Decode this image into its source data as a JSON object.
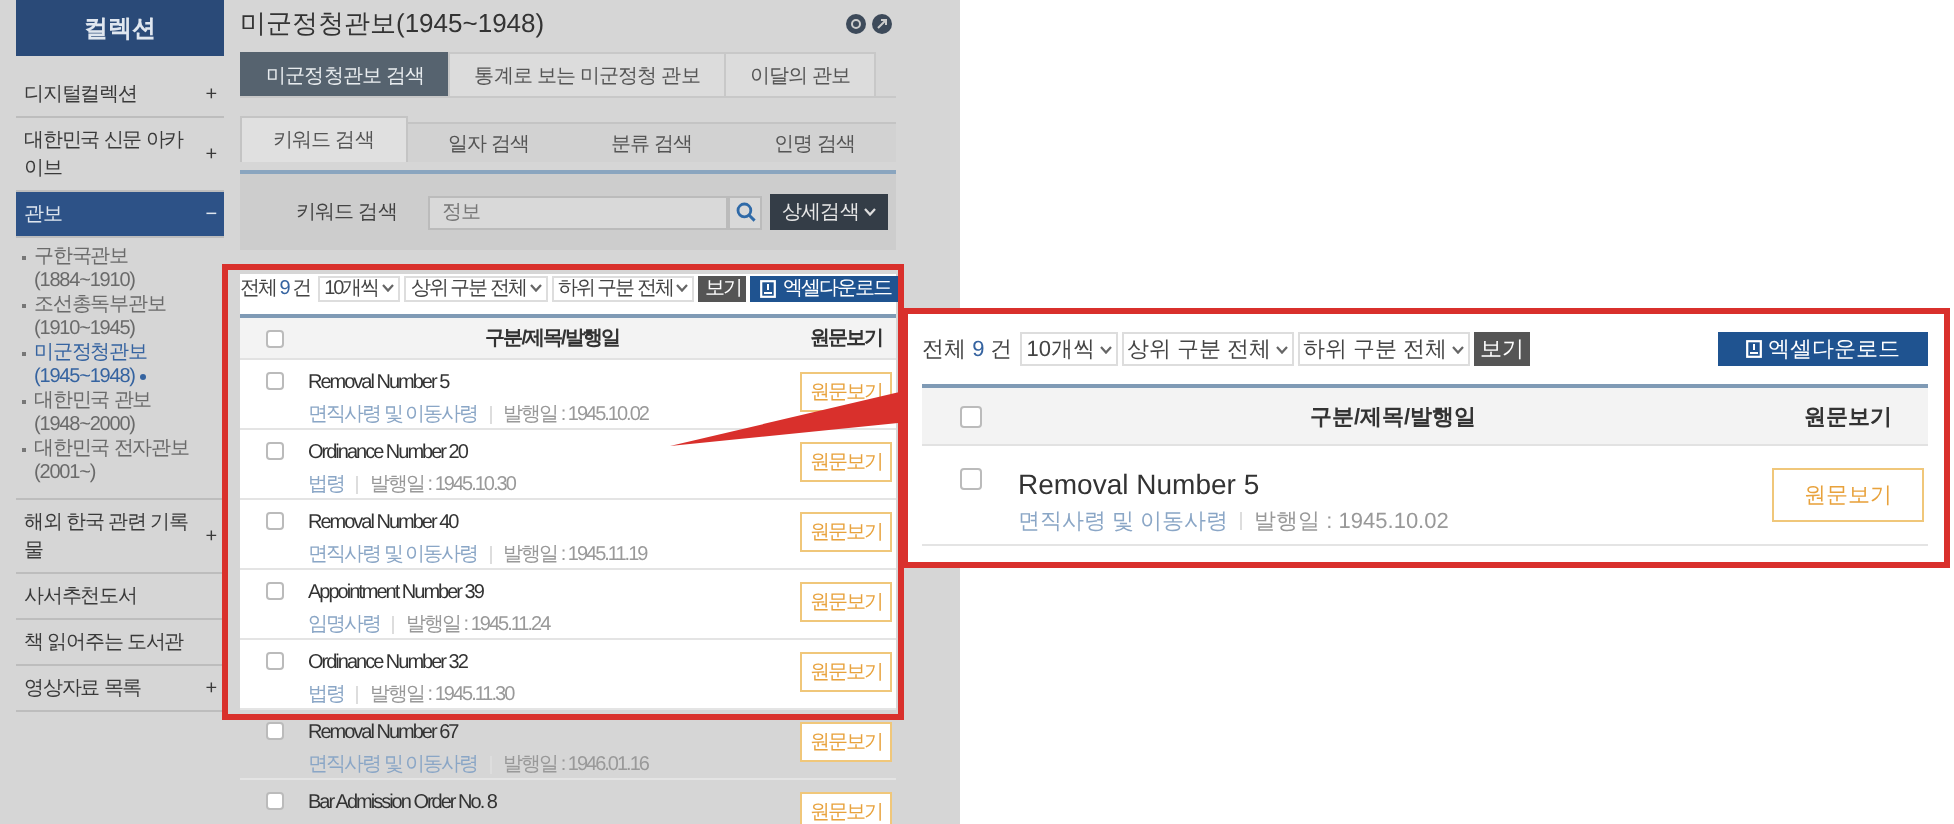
{
  "sidebar": {
    "logo": "컬렉션",
    "items": [
      {
        "label": "디지털컬렉션",
        "toggle": "+",
        "selected": false
      },
      {
        "label": "대한민국 신문 아카이브",
        "toggle": "+",
        "selected": false
      },
      {
        "label": "관보",
        "toggle": "−",
        "selected": true,
        "children": [
          {
            "label": "구한국관보(1884~1910)",
            "selected": false
          },
          {
            "label": "조선총독부관보(1910~1945)",
            "selected": false
          },
          {
            "label": "미군정청관보(1945~1948)",
            "selected": true
          },
          {
            "label": "대한민국 관보(1948~2000)",
            "selected": false
          },
          {
            "label": "대한민국 전자관보(2001~)",
            "selected": false
          }
        ]
      },
      {
        "label": "해외 한국 관련 기록물",
        "toggle": "+",
        "selected": false
      },
      {
        "label": "사서추천도서",
        "selected": false
      },
      {
        "label": "책 읽어주는 도서관",
        "selected": false
      },
      {
        "label": "영상자료 목록",
        "toggle": "+",
        "selected": false
      }
    ]
  },
  "page_title": "미군정청관보(1945~1948)",
  "tabs": [
    {
      "label": "미군정청관보 검색",
      "selected": true
    },
    {
      "label": "통계로 보는 미군정청 관보",
      "selected": false
    },
    {
      "label": "이달의 관보",
      "selected": false
    }
  ],
  "search_tabs": [
    {
      "label": "키워드 검색",
      "selected": true
    },
    {
      "label": "일자 검색",
      "selected": false
    },
    {
      "label": "분류 검색",
      "selected": false
    },
    {
      "label": "인명 검색",
      "selected": false
    }
  ],
  "search": {
    "label": "키워드 검색",
    "value": "정보",
    "detail_button": "상세검색"
  },
  "results": {
    "total_prefix": "전체",
    "total": "9",
    "total_suffix": "건",
    "filters": [
      "10개씩",
      "상위 구분 전체",
      "하위 구분 전체"
    ],
    "view_button": "보기",
    "excel_button": "엑셀다운로드",
    "select_all_checked": false,
    "columns": [
      "구분/제목/발행일",
      "원문보기"
    ],
    "rows": [
      {
        "title": "Removal Number 5",
        "category": "면직사령 및 이동사령",
        "date": "발행일 : 1945.10.02",
        "button": "원문보기",
        "checked": false
      },
      {
        "title": "Ordinance Number 20",
        "category": "법령",
        "date": "발행일 : 1945.10.30",
        "button": "원문보기",
        "checked": false
      },
      {
        "title": "Removal Number 40",
        "category": "면직사령 및 이동사령",
        "date": "발행일 : 1945.11.19",
        "button": "원문보기",
        "checked": false
      },
      {
        "title": "Appointment Number 39",
        "category": "임명사령",
        "date": "발행일 : 1945.11.24",
        "button": "원문보기",
        "checked": false
      },
      {
        "title": "Ordinance Number 32",
        "category": "법령",
        "date": "발행일 : 1945.11.30",
        "button": "원문보기",
        "checked": false
      },
      {
        "title": "Removal Number 67",
        "category": "면직사령 및 이동사령",
        "date": "발행일 : 1946.01.16",
        "button": "원문보기",
        "checked": false
      },
      {
        "title": "Bar Admission Order No. 8",
        "button": "원문보기",
        "checked": false
      }
    ]
  },
  "callout": {
    "results": {
      "total_prefix": "전체",
      "total": "9",
      "total_suffix": "건",
      "filters": [
        "10개씩",
        "상위 구분 전체",
        "하위 구분 전체"
      ],
      "view_button": "보기",
      "excel_button": "엑셀다운로드",
      "select_all_checked": false,
      "columns": [
        "구분/제목/발행일",
        "원문보기"
      ],
      "rows": [
        {
          "title": "Removal Number 5",
          "category": "면직사령 및 이동사령",
          "date": "발행일 : 1945.10.02",
          "button": "원문보기",
          "checked": false
        }
      ]
    }
  }
}
